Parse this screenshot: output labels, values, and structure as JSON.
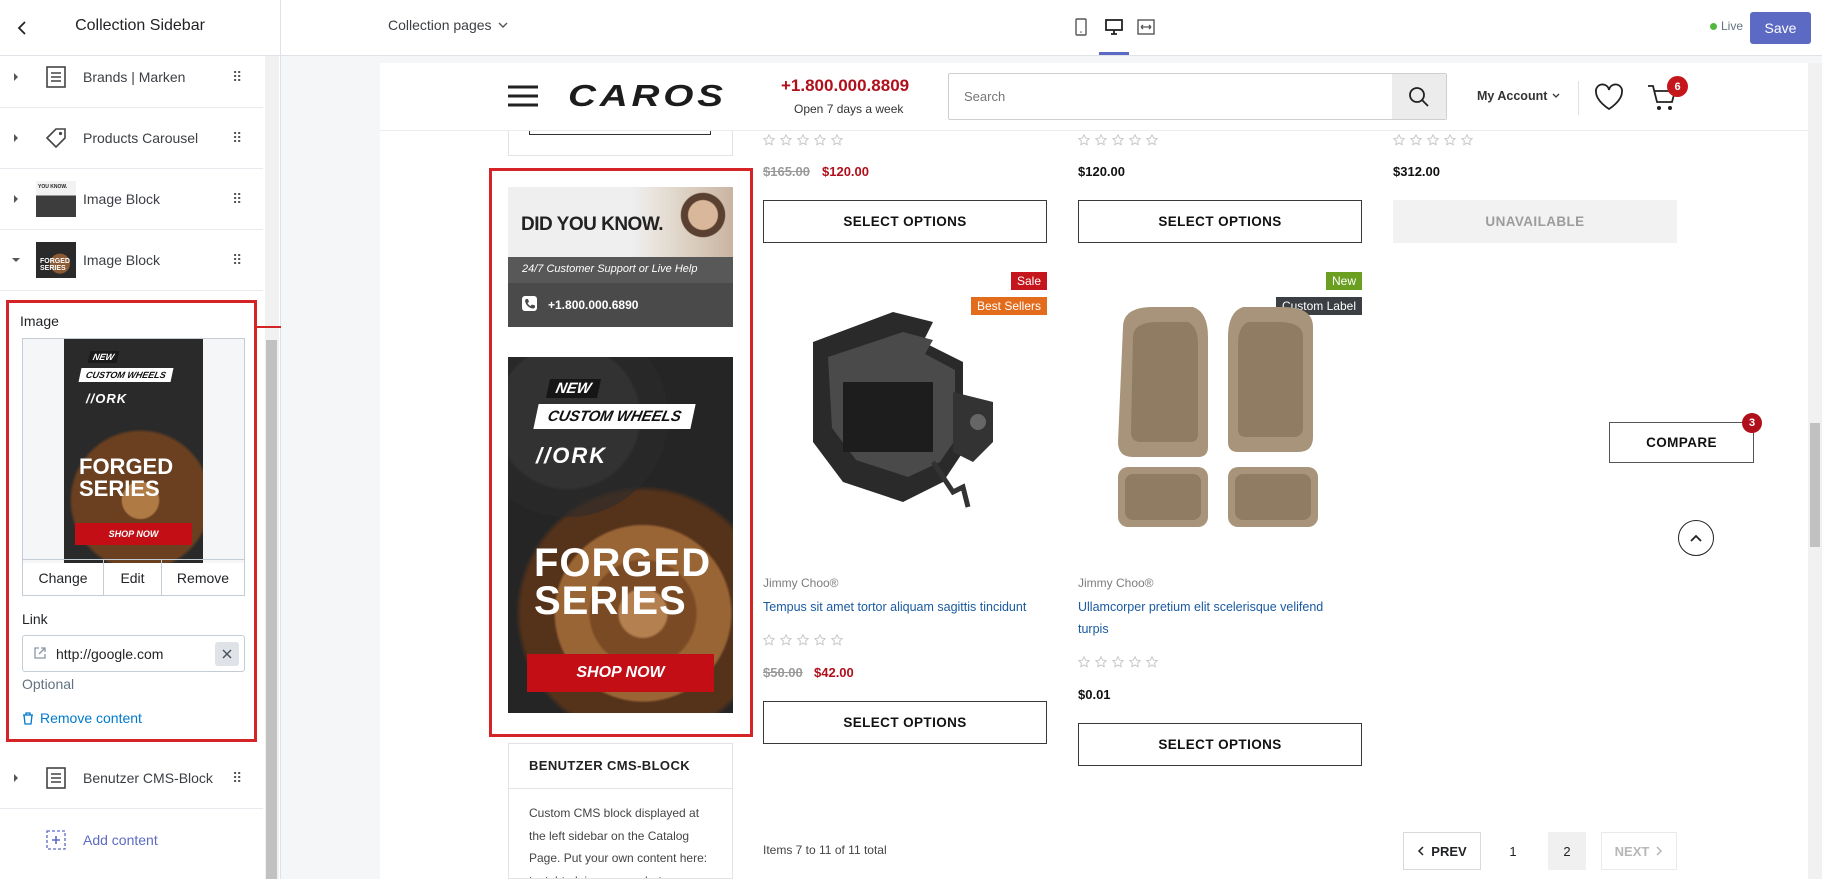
{
  "editor": {
    "sidebar_title": "Collection Sidebar",
    "template_select": "Collection pages",
    "live_label": "Live",
    "save_label": "Save",
    "colors": {
      "save": "#5c6ac4",
      "live_dot": "#50b83c",
      "highlight": "#d42428"
    }
  },
  "sidebar": {
    "items": [
      {
        "label": "Brands | Marken",
        "icon": "page-icon"
      },
      {
        "label": "Products Carousel",
        "icon": "tag-icon"
      },
      {
        "label": "Image Block",
        "icon": "image-thumbnail-icon"
      },
      {
        "label": "Image Block",
        "icon": "image-thumbnail-icon"
      },
      {
        "label": "Benutzer CMS-Block",
        "icon": "page-icon"
      }
    ],
    "add_content": "Add content"
  },
  "panel": {
    "image_label": "Image",
    "change": "Change",
    "edit": "Edit",
    "remove": "Remove",
    "link_label": "Link",
    "link_value": "http://google.com",
    "optional": "Optional",
    "remove_content": "Remove content",
    "thumb": {
      "new": "NEW",
      "custom": "CUSTOM WHEELS",
      "brand": "//ORK",
      "forged": "FORGED",
      "series": "SERIES",
      "shop": "SHOP NOW"
    }
  },
  "store": {
    "logo": "CAROS",
    "phone": "+1.800.000.8809",
    "phone_sub": "Open 7 days a week",
    "search_placeholder": "Search",
    "account": "My Account",
    "cart_count": "6",
    "compare": "COMPARE",
    "compare_count": "3",
    "colors": {
      "red": "#b0101c",
      "sale_badge": "#c4161c",
      "bestseller": "#e36c1c",
      "new_badge": "#6a9f20",
      "custom_badge": "#3b3e42"
    }
  },
  "banner1": {
    "title": "DID YOU KNOW.",
    "sub": "24/7 Customer Support or Live Help",
    "phone": "+1.800.000.6890"
  },
  "banner2": {
    "new": "NEW",
    "custom": "CUSTOM WHEELS",
    "brand": "//ORK",
    "forged": "FORGED",
    "series": "SERIES",
    "shop": "SHOP NOW"
  },
  "cms": {
    "title": "BENUTZER CMS-BLOCK",
    "lines": [
      "Custom CMS block displayed at",
      "the left sidebar on the Catalog",
      "Page. Put your own content here:",
      "text, html, images... whatever you"
    ]
  },
  "top_products": [
    {
      "old": "$165.00",
      "price": "$120.00",
      "button": "SELECT OPTIONS"
    },
    {
      "old": "",
      "price": "$120.00",
      "button": "SELECT OPTIONS"
    },
    {
      "old": "",
      "price": "$312.00",
      "button": "UNAVAILABLE"
    }
  ],
  "products": [
    {
      "badges": [
        "Sale",
        "Best Sellers"
      ],
      "vendor": "Jimmy Choo®",
      "title_lines": [
        "Tempus sit amet tortor aliquam sagittis tincidunt"
      ],
      "old": "$50.00",
      "price": "$42.00",
      "button": "SELECT OPTIONS",
      "image": "dash-kit-image"
    },
    {
      "badges": [
        "New",
        "Custom Label"
      ],
      "vendor": "Jimmy Choo®",
      "title_lines": [
        "Ullamcorper pretium elit scelerisque velifend",
        "turpis"
      ],
      "old": "",
      "price": "$0.01",
      "button": "SELECT OPTIONS",
      "image": "floor-mats-image"
    }
  ],
  "pagination": {
    "summary": "Items 7 to 11 of 11 total",
    "prev": "PREV",
    "pages": [
      "1",
      "2"
    ],
    "next": "NEXT"
  }
}
